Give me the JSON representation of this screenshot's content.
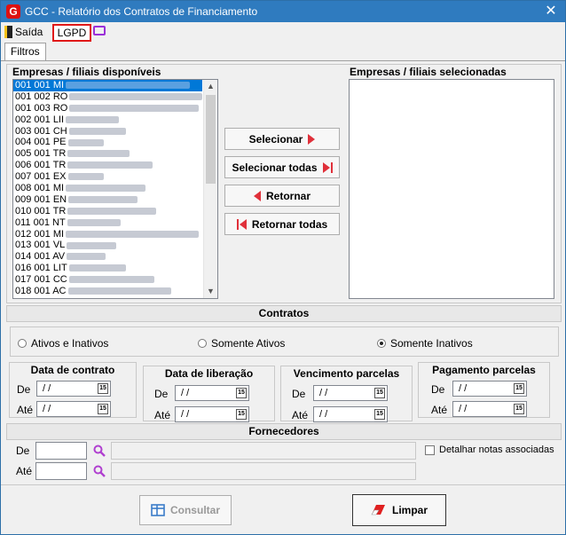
{
  "window": {
    "title": "GCC - Relatório dos Contratos de Financiamento",
    "app_icon_letter": "G",
    "close_glyph": "✕"
  },
  "toolbar": {
    "exit_label": "Saída",
    "lgpd_label": "LGPD"
  },
  "tabs": [
    {
      "label": "Filtros"
    }
  ],
  "companies": {
    "available_label": "Empresas / filiais disponíveis",
    "selected_label": "Empresas / filiais selecionadas",
    "available": [
      {
        "code": "001 001 MI"
      },
      {
        "code": "001 002 RO"
      },
      {
        "code": "001 003 RO"
      },
      {
        "code": "002 001 LII"
      },
      {
        "code": "003 001 CH"
      },
      {
        "code": "004 001 PE"
      },
      {
        "code": "005 001 TR"
      },
      {
        "code": "006 001 TR"
      },
      {
        "code": "007 001 EX"
      },
      {
        "code": "008 001 MI"
      },
      {
        "code": "009 001 EN"
      },
      {
        "code": "010 001 TR"
      },
      {
        "code": "011 001 NT"
      },
      {
        "code": "012 001 MI"
      },
      {
        "code": "013 001 VL"
      },
      {
        "code": "014 001 AV"
      },
      {
        "code": "016 001 LIT"
      },
      {
        "code": "017 001 CC"
      },
      {
        "code": "018 001 AC"
      }
    ]
  },
  "buttons": {
    "select": "Selecionar",
    "select_all": "Selecionar todas",
    "return": "Retornar",
    "return_all": "Retornar todas",
    "consult": "Consultar",
    "clear": "Limpar"
  },
  "contracts": {
    "label": "Contratos",
    "options": [
      {
        "label": "Ativos e Inativos",
        "checked": false
      },
      {
        "label": "Somente Ativos",
        "checked": false
      },
      {
        "label": "Somente Inativos",
        "checked": true
      }
    ]
  },
  "date_filters": [
    {
      "title": "Data de contrato",
      "from_label": "De",
      "to_label": "Até",
      "from_value": " / /",
      "to_value": " / /"
    },
    {
      "title": "Data de liberação",
      "from_label": "De",
      "to_label": "Até",
      "from_value": " / /",
      "to_value": " / /"
    },
    {
      "title": "Vencimento parcelas",
      "from_label": "De",
      "to_label": "Até",
      "from_value": " / /",
      "to_value": " / /"
    },
    {
      "title": "Pagamento parcelas",
      "from_label": "De",
      "to_label": "Até",
      "from_value": " / /",
      "to_value": " / /"
    }
  ],
  "calendar_icon_text": "15",
  "suppliers": {
    "label": "Fornecedores",
    "from_label": "De",
    "to_label": "Até",
    "from_value": "",
    "to_value": "",
    "detail_label": "Detalhar notas associadas"
  }
}
